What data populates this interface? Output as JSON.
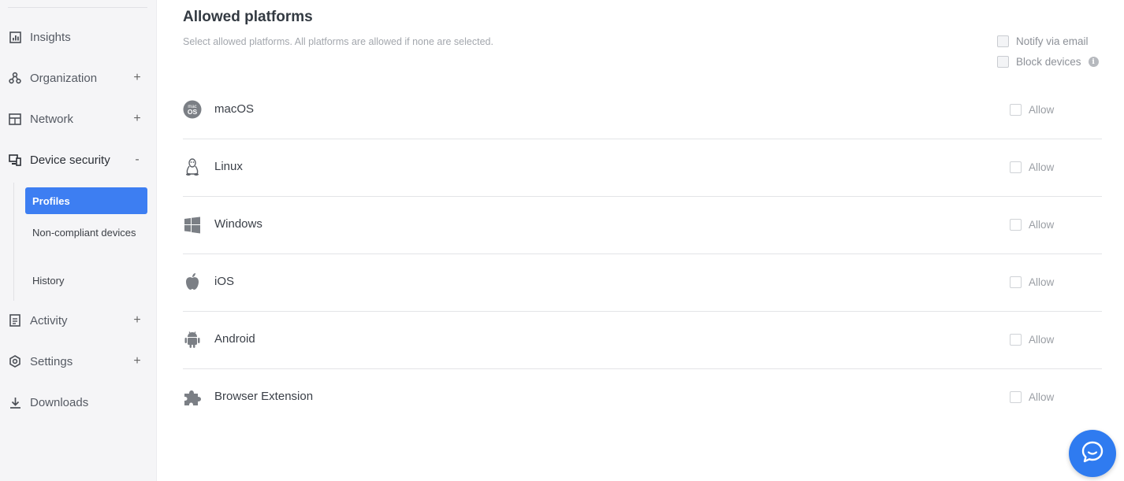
{
  "sidebar": {
    "items": [
      {
        "label": "Insights",
        "icon": "chart-icon",
        "toggle": ""
      },
      {
        "label": "Organization",
        "icon": "organization-icon",
        "toggle": "+"
      },
      {
        "label": "Network",
        "icon": "network-icon",
        "toggle": "+"
      },
      {
        "label": "Device security",
        "icon": "device-security-icon",
        "toggle": "-"
      },
      {
        "label": "Activity",
        "icon": "activity-icon",
        "toggle": "+"
      },
      {
        "label": "Settings",
        "icon": "settings-icon",
        "toggle": "+"
      },
      {
        "label": "Downloads",
        "icon": "download-icon",
        "toggle": ""
      }
    ],
    "sub_items": [
      {
        "label": "Profiles",
        "selected": true
      },
      {
        "label": "Non-compliant devices",
        "selected": false
      },
      {
        "label": "History",
        "selected": false
      }
    ]
  },
  "main": {
    "title": "Allowed platforms",
    "subtitle": "Select allowed platforms. All platforms are allowed if none are selected.",
    "options": {
      "notify_label": "Notify via email",
      "block_label": "Block devices"
    },
    "platforms": [
      {
        "name": "macOS",
        "icon": "macos-icon",
        "allow_label": "Allow"
      },
      {
        "name": "Linux",
        "icon": "linux-icon",
        "allow_label": "Allow"
      },
      {
        "name": "Windows",
        "icon": "windows-icon",
        "allow_label": "Allow"
      },
      {
        "name": "iOS",
        "icon": "apple-icon",
        "allow_label": "Allow"
      },
      {
        "name": "Android",
        "icon": "android-icon",
        "allow_label": "Allow"
      },
      {
        "name": "Browser Extension",
        "icon": "puzzle-icon",
        "allow_label": "Allow"
      }
    ]
  },
  "chat": {
    "icon": "chat-icon"
  },
  "colors": {
    "accent": "#3d7ef2",
    "chat": "#2f7bf0",
    "sidebar_bg": "#f5f5f7"
  }
}
